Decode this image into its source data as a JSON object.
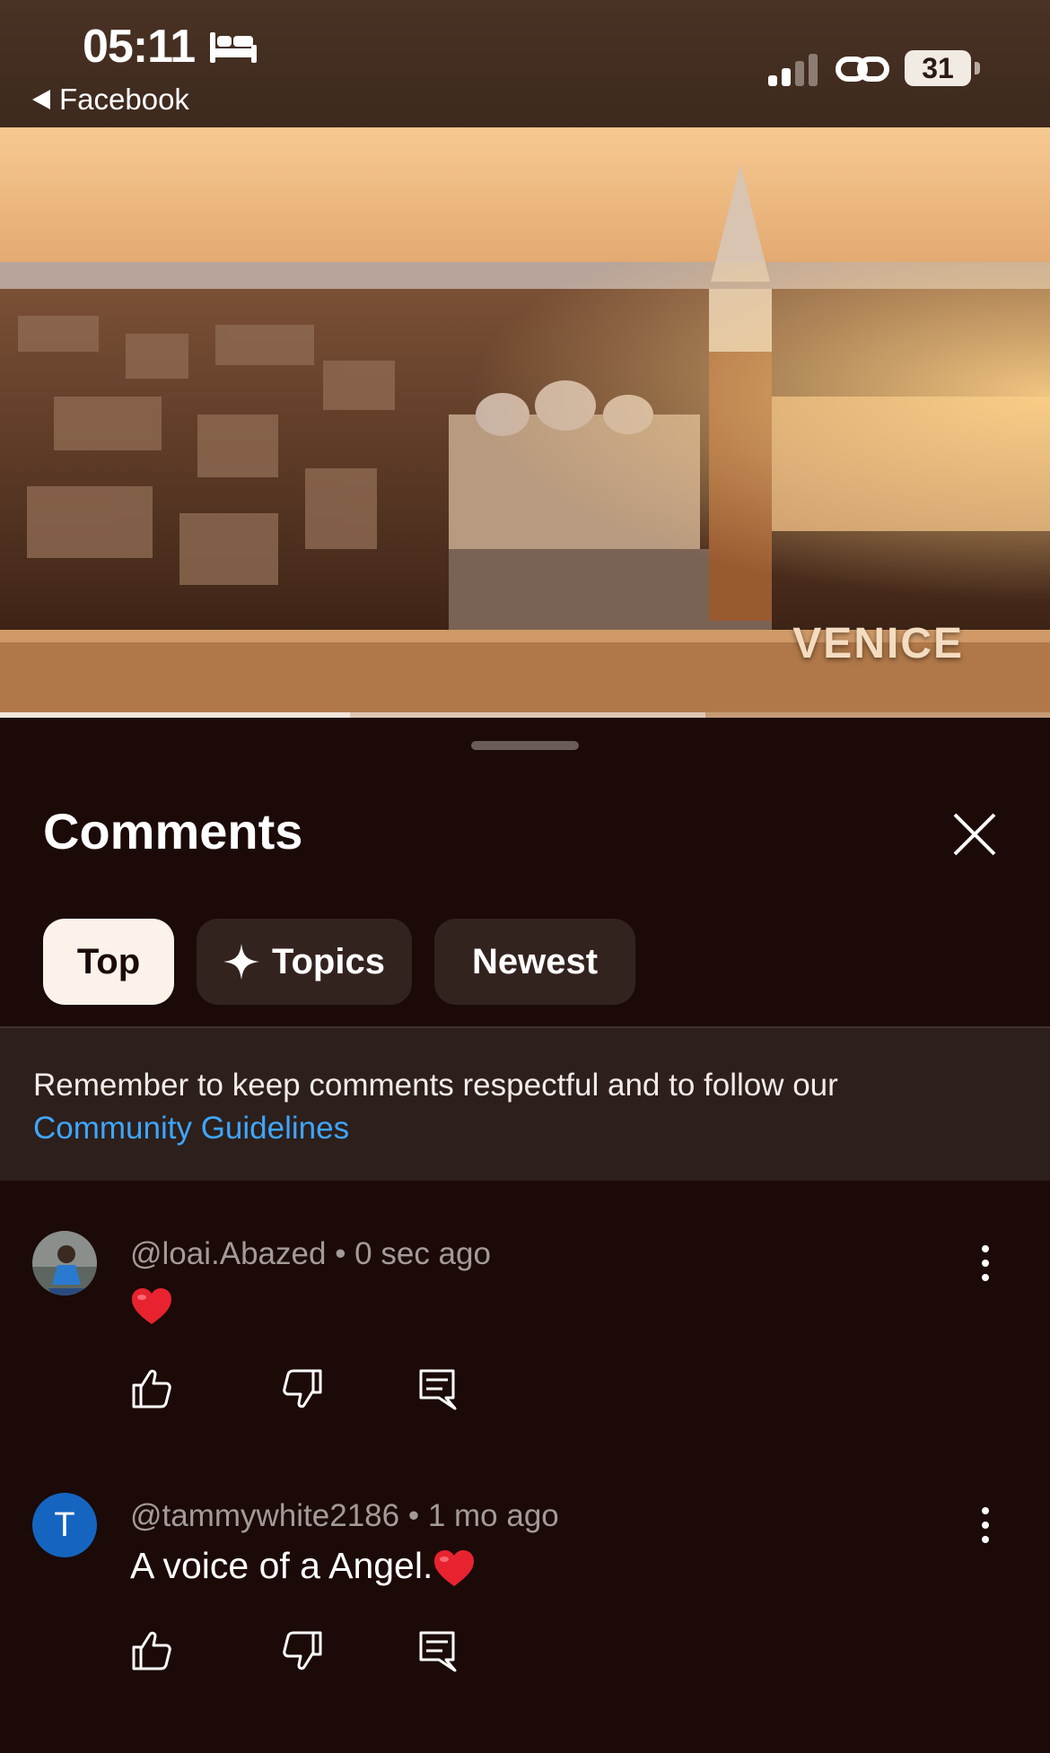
{
  "status_bar": {
    "time": "05:11",
    "back_app": "Facebook",
    "battery": "31",
    "icons": [
      "bed-icon",
      "cellular-signal-icon",
      "personal-hotspot-icon",
      "battery-icon"
    ]
  },
  "video": {
    "caption": "VENICE",
    "progress_fraction": 0.333,
    "buffered_fraction": 0.672
  },
  "sheet": {
    "title": "Comments",
    "filters": [
      {
        "label": "Top",
        "selected": true
      },
      {
        "label": "Topics",
        "selected": false,
        "icon": "sparkle-icon"
      },
      {
        "label": "Newest",
        "selected": false
      }
    ],
    "notice_text": "Remember to keep comments respectful and to follow our",
    "notice_link": "Community Guidelines"
  },
  "comments": [
    {
      "author": "@loai.Abazed",
      "time": "0 sec ago",
      "text": "",
      "emoji": "red-heart-icon"
    },
    {
      "author": "@tammywhite2186",
      "time": "1 mo ago",
      "text": "A voice of a Angel.",
      "emoji": "red-heart-icon",
      "avatar_letter": "T"
    }
  ],
  "colors": {
    "background": "#1b0a08",
    "chip_selected": "#fbf3ea",
    "chip": "#33231f",
    "link": "#3ea6ff",
    "avatar_t": "#1565c0"
  }
}
